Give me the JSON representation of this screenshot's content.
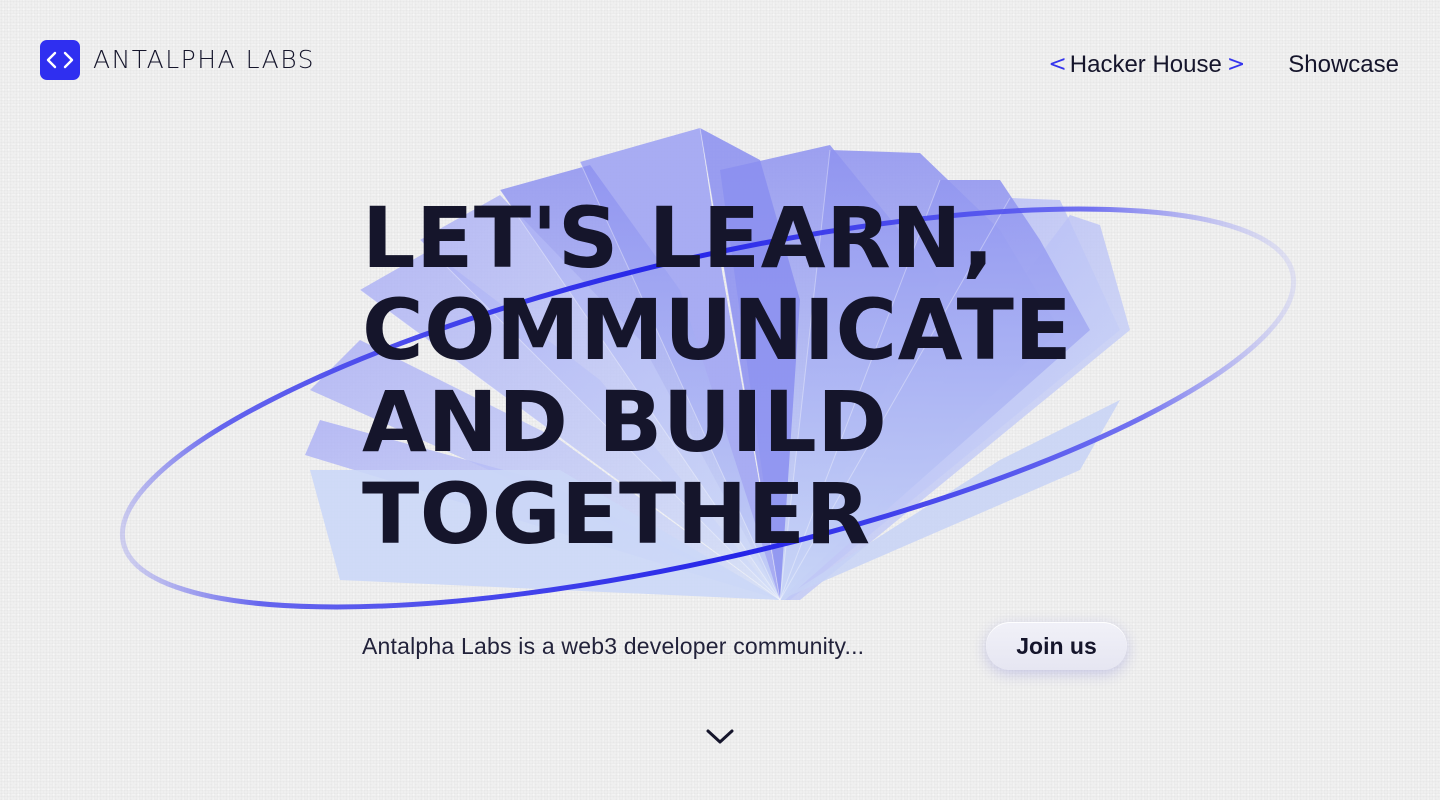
{
  "header": {
    "logo_mark": "<>",
    "logo_text": "ANTALPHA LABS",
    "nav": [
      {
        "label": "Hacker House",
        "active": true
      },
      {
        "label": "Showcase",
        "active": false
      }
    ],
    "nav_brackets": {
      "left": "<",
      "right": ">"
    }
  },
  "hero": {
    "headline_lines": [
      "LET'S LEARN,",
      "COMMUNICATE",
      "AND BUILD",
      "TOGETHER"
    ],
    "tagline": "Antalpha Labs is a web3 developer community...",
    "cta_label": "Join us",
    "scroll_icon": "chevron-down-icon",
    "art_icon": "open-book-illustration"
  },
  "colors": {
    "background": "#efefef",
    "accent": "#2f2ff0",
    "text": "#15152b",
    "book_tint": "#9fa5f3"
  }
}
